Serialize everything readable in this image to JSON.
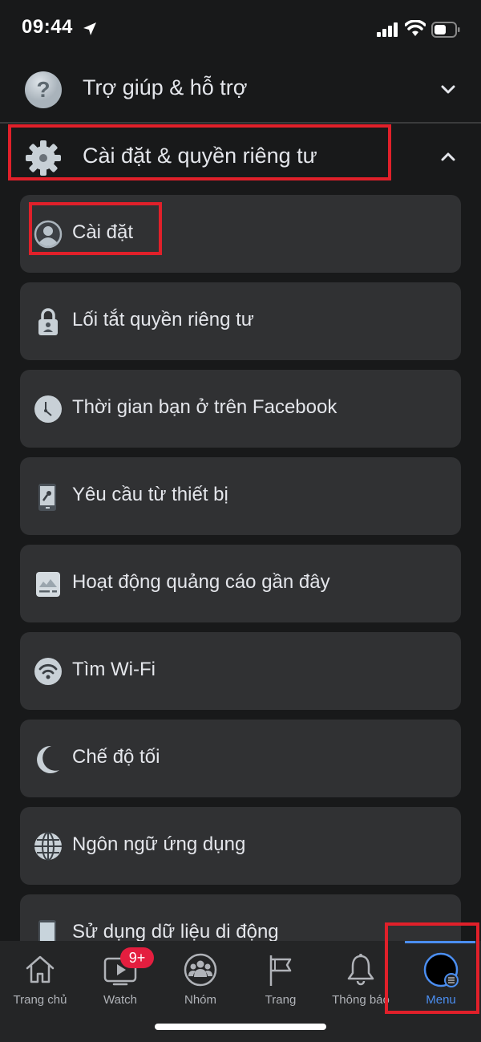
{
  "status_bar": {
    "time": "09:44",
    "icons": [
      "location-arrow-icon",
      "cellular-signal-icon",
      "wifi-icon",
      "battery-icon"
    ]
  },
  "sections": [
    {
      "label": "Trợ giúp & hỗ trợ",
      "icon": "question-circle-icon",
      "expanded": false
    },
    {
      "label": "Cài đặt & quyền riêng tư",
      "icon": "gear-icon",
      "expanded": true,
      "highlighted": true
    }
  ],
  "settings_items": [
    {
      "label": "Cài đặt",
      "icon": "user-circle-icon",
      "highlighted": true
    },
    {
      "label": "Lối tắt quyền riêng tư",
      "icon": "lock-icon"
    },
    {
      "label": "Thời gian bạn ở trên Facebook",
      "icon": "clock-icon"
    },
    {
      "label": "Yêu cầu từ thiết bị",
      "icon": "phone-key-icon"
    },
    {
      "label": "Hoạt động quảng cáo gần đây",
      "icon": "ad-image-icon"
    },
    {
      "label": "Tìm Wi-Fi",
      "icon": "wifi-circle-icon"
    },
    {
      "label": "Chế độ tối",
      "icon": "moon-icon"
    },
    {
      "label": "Ngôn ngữ ứng dụng",
      "icon": "globe-icon"
    },
    {
      "label": "Sử dụng dữ liệu di động",
      "icon": "mobile-phone-icon"
    }
  ],
  "tab_bar": {
    "tabs": [
      {
        "label": "Trang chủ",
        "icon": "home-icon"
      },
      {
        "label": "Watch",
        "icon": "video-tv-icon",
        "badge": "9+"
      },
      {
        "label": "Nhóm",
        "icon": "groups-icon"
      },
      {
        "label": "Trang",
        "icon": "flag-icon"
      },
      {
        "label": "Thông báo",
        "icon": "bell-icon"
      },
      {
        "label": "Menu",
        "icon": "avatar-menu-icon",
        "active": true,
        "highlighted": true
      }
    ]
  },
  "colors": {
    "background": "#18191a",
    "card": "#303133",
    "text": "#e4e6eb",
    "accent": "#4b8ef0",
    "badge": "#e41e3f",
    "highlight_box": "#e0202a"
  }
}
